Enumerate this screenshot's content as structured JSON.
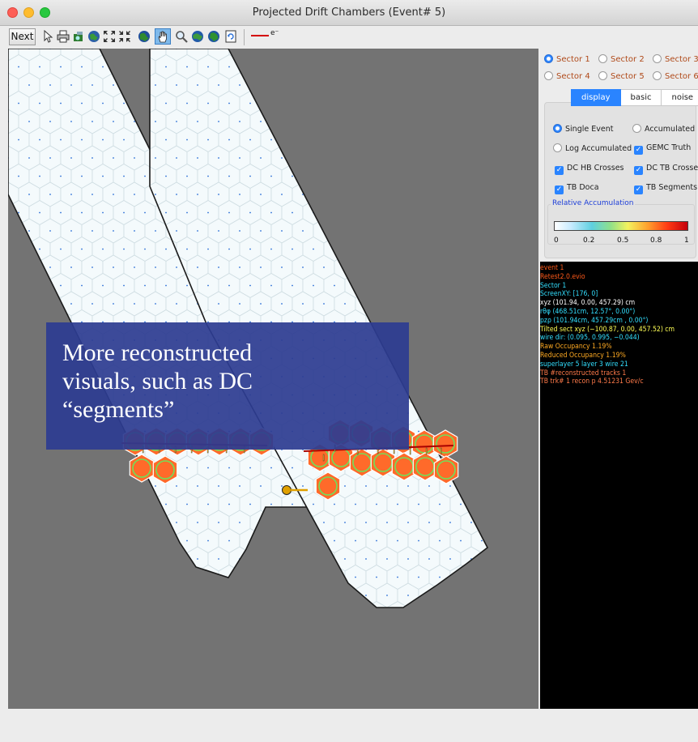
{
  "window": {
    "title": "Projected Drift Chambers  (Event# 5)"
  },
  "toolbar": {
    "next_label": "Next",
    "tools": [
      "pointer-icon",
      "print-icon",
      "camera-icon",
      "world-icon",
      "expand-icon",
      "shrink-icon",
      "globe-zoom-icon",
      "hand-pan-icon",
      "magnifier-icon",
      "world-in-icon",
      "world-out-icon",
      "refresh-icon"
    ],
    "track_legend_label": "e⁻",
    "track_legend_color": "#d40000"
  },
  "view": {
    "background_color": "#737373",
    "overlay_text": "More reconstructed visuals, such as DC “segments”"
  },
  "sectors": [
    {
      "label": "Sector 1",
      "selected": true
    },
    {
      "label": "Sector 2",
      "selected": false
    },
    {
      "label": "Sector 3",
      "selected": false
    },
    {
      "label": "Sector 4",
      "selected": false
    },
    {
      "label": "Sector 5",
      "selected": false
    },
    {
      "label": "Sector 6",
      "selected": false
    }
  ],
  "tabs": [
    {
      "label": "display",
      "active": true
    },
    {
      "label": "basic",
      "active": false
    },
    {
      "label": "noise",
      "active": false
    }
  ],
  "display_options": {
    "single_event": "Single Event",
    "accumulated": "Accumulated",
    "log_accumulated": "Log Accumulated",
    "gemc_truth": "GEMC Truth",
    "dc_hb_crosses": "DC HB Crosses",
    "dc_tb_crosses": "DC TB Crosses",
    "tb_doca": "TB Doca",
    "tb_segments": "TB Segments"
  },
  "accumulation": {
    "title": "Relative Accumulation",
    "ticks": [
      "0",
      "0.2",
      "0.5",
      "0.8",
      "1"
    ]
  },
  "info_lines": [
    {
      "text": "event 1",
      "color": "#ff5a1a"
    },
    {
      "text": "Retest2.0.evio",
      "color": "#ff5a1a"
    },
    {
      "text": "Sector 1",
      "color": "#33dfff"
    },
    {
      "text": "ScreenXY: [176, 0]",
      "color": "#33dfff"
    },
    {
      "text": "xyz (101.94, 0.00, 457.29) cm",
      "color": "#ffffff"
    },
    {
      "text": "rθφ (468.51cm, 12.57°, 0.00°)",
      "color": "#33dfff"
    },
    {
      "text": "pzρ (101.94cm, 457.29cm , 0.00°)",
      "color": "#33dfff"
    },
    {
      "text": "Tilted sect xyz (−100.87, 0.00, 457.52) cm",
      "color": "#ffff55"
    },
    {
      "text": "wire dir: (0.095, 0.995, −0.044)",
      "color": "#33dfff"
    },
    {
      "text": "Raw Occupancy 1.19%",
      "color": "#ffaa22"
    },
    {
      "text": "Reduced Occupancy 1.19%",
      "color": "#ffaa22"
    },
    {
      "text": "superlayer 5  layer 3  wire 21",
      "color": "#33dfff"
    },
    {
      "text": "TB #reconstructed tracks 1",
      "color": "#ff7a4a"
    },
    {
      "text": "TB trk# 1 recon p 4.51231 Gev/c",
      "color": "#ff7a4a"
    }
  ]
}
